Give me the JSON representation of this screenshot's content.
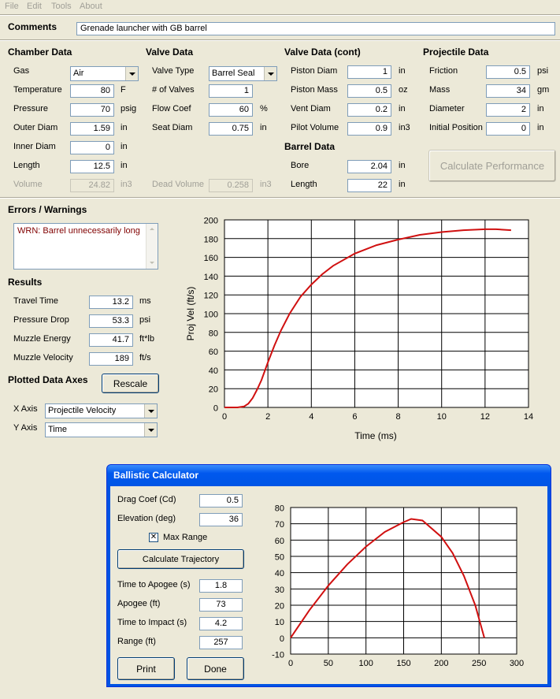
{
  "menu": [
    "File",
    "Edit",
    "Tools",
    "About"
  ],
  "comments": {
    "label": "Comments",
    "value": "Grenade launcher with GB barrel"
  },
  "chamber": {
    "title": "Chamber Data",
    "gas": {
      "label": "Gas",
      "value": "Air"
    },
    "temperature": {
      "label": "Temperature",
      "value": "80",
      "unit": "F"
    },
    "pressure": {
      "label": "Pressure",
      "value": "70",
      "unit": "psig"
    },
    "outer_diam": {
      "label": "Outer Diam",
      "value": "1.59",
      "unit": "in"
    },
    "inner_diam": {
      "label": "Inner Diam",
      "value": "0",
      "unit": "in"
    },
    "length": {
      "label": "Length",
      "value": "12.5",
      "unit": "in"
    },
    "volume": {
      "label": "Volume",
      "value": "24.82",
      "unit": "in3"
    }
  },
  "valve": {
    "title": "Valve Data",
    "valve_type": {
      "label": "Valve Type",
      "value": "Barrel Seal"
    },
    "num_valves": {
      "label": "# of Valves",
      "value": "1"
    },
    "flow_coef": {
      "label": "Flow Coef",
      "value": "60",
      "unit": "%"
    },
    "seat_diam": {
      "label": "Seat Diam",
      "value": "0.75",
      "unit": "in"
    },
    "dead_volume": {
      "label": "Dead Volume",
      "value": "0.258",
      "unit": "in3"
    }
  },
  "valve_cont": {
    "title": "Valve Data (cont)",
    "piston_diam": {
      "label": "Piston Diam",
      "value": "1",
      "unit": "in"
    },
    "piston_mass": {
      "label": "Piston Mass",
      "value": "0.5",
      "unit": "oz"
    },
    "vent_diam": {
      "label": "Vent Diam",
      "value": "0.2",
      "unit": "in"
    },
    "pilot_volume": {
      "label": "Pilot Volume",
      "value": "0.9",
      "unit": "in3"
    }
  },
  "barrel": {
    "title": "Barrel Data",
    "bore": {
      "label": "Bore",
      "value": "2.04",
      "unit": "in"
    },
    "length": {
      "label": "Length",
      "value": "22",
      "unit": "in"
    }
  },
  "projectile": {
    "title": "Projectile Data",
    "friction": {
      "label": "Friction",
      "value": "0.5",
      "unit": "psi"
    },
    "mass": {
      "label": "Mass",
      "value": "34",
      "unit": "gm"
    },
    "diameter": {
      "label": "Diameter",
      "value": "2",
      "unit": "in"
    },
    "initial_position": {
      "label": "Initial Position",
      "value": "0",
      "unit": "in"
    }
  },
  "calc_perf_label": "Calculate Performance",
  "errors": {
    "title": "Errors / Warnings",
    "text": "WRN: Barrel unnecessarily long"
  },
  "results": {
    "title": "Results",
    "travel_time": {
      "label": "Travel Time",
      "value": "13.2",
      "unit": "ms"
    },
    "pressure_drop": {
      "label": "Pressure Drop",
      "value": "53.3",
      "unit": "psi"
    },
    "muzzle_energy": {
      "label": "Muzzle Energy",
      "value": "41.7",
      "unit": "ft*lb"
    },
    "muzzle_velocity": {
      "label": "Muzzle Velocity",
      "value": "189",
      "unit": "ft/s"
    }
  },
  "axes": {
    "title": "Plotted Data Axes",
    "rescale_label": "Rescale",
    "x_axis": {
      "label": "X Axis",
      "value": "Projectile Velocity"
    },
    "y_axis": {
      "label": "Y Axis",
      "value": "Time"
    }
  },
  "ballistic": {
    "title": "Ballistic Calculator",
    "drag_coef": {
      "label": "Drag Coef (Cd)",
      "value": "0.5"
    },
    "elevation": {
      "label": "Elevation (deg)",
      "value": "36"
    },
    "max_range": {
      "label": "Max Range",
      "checked": true
    },
    "calc_traj_label": "Calculate Trajectory",
    "time_to_apogee": {
      "label": "Time to Apogee (s)",
      "value": "1.8"
    },
    "apogee": {
      "label": "Apogee (ft)",
      "value": "73"
    },
    "time_to_impact": {
      "label": "Time to Impact (s)",
      "value": "4.2"
    },
    "range": {
      "label": "Range (ft)",
      "value": "257"
    },
    "print_label": "Print",
    "done_label": "Done"
  },
  "colors": {
    "curve": "#d01010",
    "dialog_title": "#0058ee"
  },
  "chart_data": [
    {
      "type": "line",
      "title": "",
      "xlabel": "Time (ms)",
      "ylabel": "Proj Vel (ft/s)",
      "xlim": [
        0,
        14
      ],
      "ylim": [
        0,
        200
      ],
      "xticks": [
        0,
        2,
        4,
        6,
        8,
        10,
        12,
        14
      ],
      "yticks": [
        0,
        20,
        40,
        60,
        80,
        100,
        120,
        140,
        160,
        180,
        200
      ],
      "grid": true,
      "series": [
        {
          "x": [
            0,
            0.6,
            0.9,
            1.1,
            1.3,
            1.5,
            1.7,
            2.0,
            2.3,
            2.6,
            3.0,
            3.5,
            4.0,
            4.5,
            5.0,
            6.0,
            7.0,
            8.0,
            9.0,
            10.0,
            11.0,
            12.0,
            12.5,
            13.2
          ],
          "y": [
            0,
            0,
            1,
            4,
            10,
            19,
            29,
            48,
            66,
            82,
            100,
            118,
            131,
            142,
            151,
            164,
            173,
            179,
            184,
            187,
            189,
            190,
            190,
            189
          ]
        }
      ]
    },
    {
      "type": "line",
      "title": "",
      "xlabel": "",
      "ylabel": "",
      "xlim": [
        0,
        300
      ],
      "ylim": [
        -10,
        80
      ],
      "xticks": [
        0,
        50,
        100,
        150,
        200,
        250,
        300
      ],
      "yticks": [
        -10,
        0,
        10,
        20,
        30,
        40,
        50,
        60,
        70,
        80
      ],
      "grid": true,
      "series": [
        {
          "x": [
            0,
            25,
            50,
            75,
            100,
            125,
            150,
            160,
            175,
            200,
            215,
            230,
            245,
            257
          ],
          "y": [
            0,
            17,
            32,
            45,
            56,
            65,
            71,
            73,
            72,
            62,
            52,
            38,
            20,
            0
          ]
        }
      ]
    }
  ]
}
